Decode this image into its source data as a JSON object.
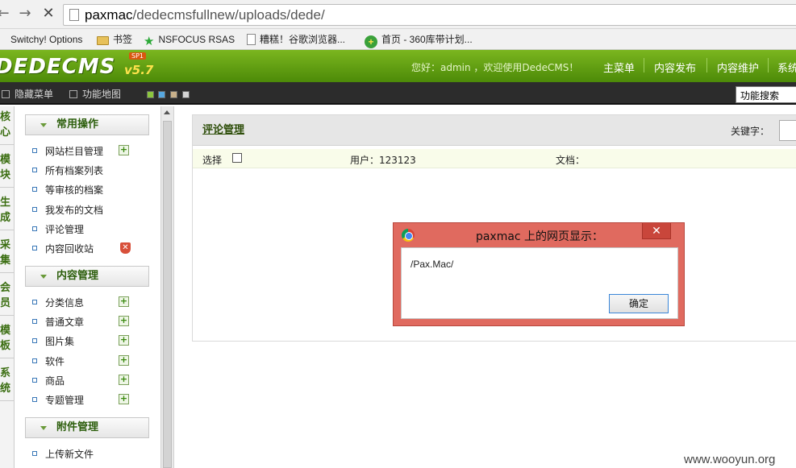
{
  "browser": {
    "url_host": "paxmac",
    "url_path": "/dedecmsfullnew/uploads/dede/",
    "bookmarks": [
      "Switchy! Options",
      "书签",
      "NSFOCUS RSAS",
      "糟糕！谷歌浏览器...",
      "首页 - 360库带计划..."
    ]
  },
  "header": {
    "logo": "DEDECMS",
    "version": "v5.7",
    "sp": "SP1",
    "welcome": "您好：admin ，欢迎使用DedeCMS！",
    "nav": [
      "主菜单",
      "内容发布",
      "内容维护",
      "系统"
    ]
  },
  "toolbar": {
    "hide_menu": "隐藏菜单",
    "site_map": "功能地图",
    "search_value": "功能搜索"
  },
  "sidetabs": [
    [
      "核",
      "心"
    ],
    [
      "模",
      "块"
    ],
    [
      "生",
      "成"
    ],
    [
      "采",
      "集"
    ],
    [
      "会",
      "员"
    ],
    [
      "模",
      "板"
    ],
    [
      "系",
      "统"
    ]
  ],
  "menu": {
    "groups": [
      {
        "title": "常用操作",
        "items": [
          "网站栏目管理",
          "所有档案列表",
          "等审核的档案",
          "我发布的文档",
          "评论管理",
          "内容回收站"
        ]
      },
      {
        "title": "内容管理",
        "items": [
          "分类信息",
          "普通文章",
          "图片集",
          "软件",
          "商品",
          "专题管理"
        ]
      },
      {
        "title": "附件管理",
        "items": [
          "上传新文件"
        ]
      }
    ]
  },
  "main": {
    "panel_title": "评论管理",
    "keyword_label": "关键字：",
    "select_label": "选择",
    "user": "用户：123123",
    "doc": "文档："
  },
  "dialog": {
    "title": "paxmac 上的网页显示：",
    "close": "✕",
    "message": "/Pax.Mac/",
    "ok": "确定"
  },
  "watermark": "www.wooyun.org"
}
